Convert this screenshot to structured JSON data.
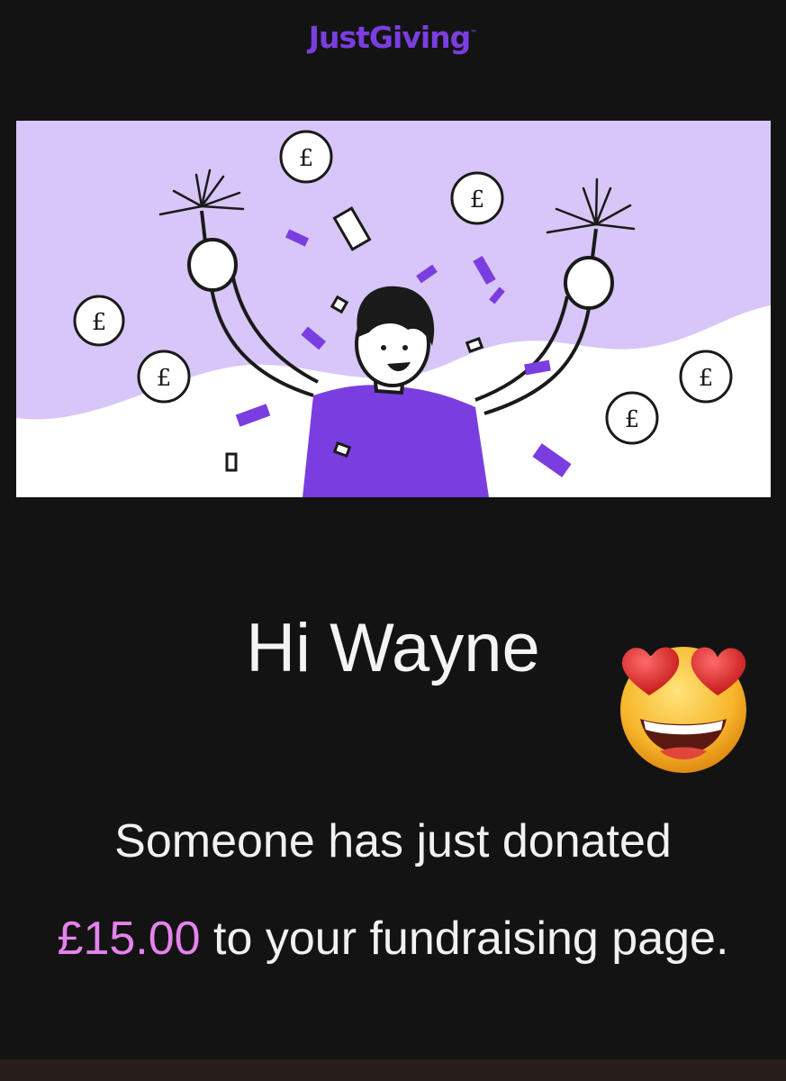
{
  "header": {
    "logo_text": "JustGiving",
    "logo_tm": "™",
    "brand_color": "#7a3ee0"
  },
  "hero": {
    "illustration": "celebrating-person-with-sparklers-coins-confetti",
    "coin_symbol": "£",
    "background_color": "#d7c6f7",
    "accent_color": "#7a3ee0"
  },
  "greeting": {
    "text": "Hi Wayne",
    "emoji": "heart-eyes-emoji"
  },
  "message": {
    "before": "Someone has just donated",
    "amount": "£15.00",
    "after": "to your fundraising page.",
    "amount_color": "#e583ee"
  }
}
